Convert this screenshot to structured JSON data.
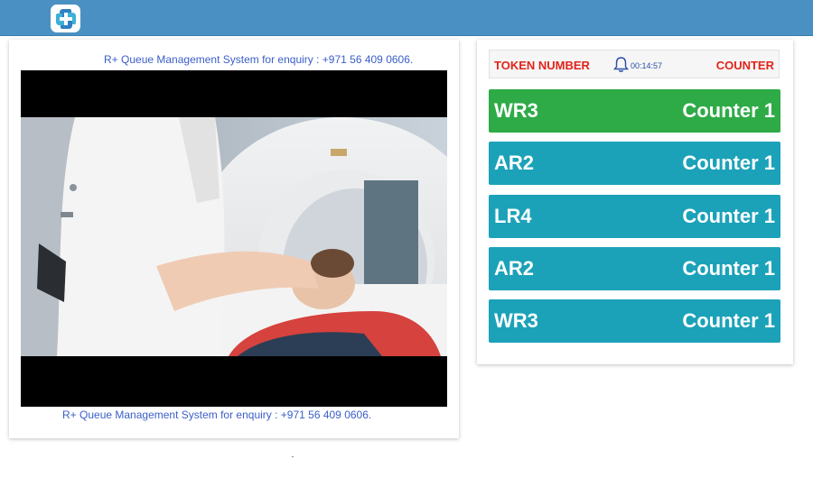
{
  "colors": {
    "topbar": "#4a90c2",
    "active_row": "#2eab47",
    "row": "#1ba2b9",
    "header_text": "#e0241b",
    "enquiry_text": "#3b5fc8"
  },
  "left_panel": {
    "enquiry_top": "R+ Queue Management System for enquiry : +971 56 409 0606.",
    "enquiry_bottom": "R+ Queue Management System for enquiry : +971 56 409 0606.",
    "video_icon": "video-player"
  },
  "right_panel": {
    "header": {
      "token_label": "TOKEN NUMBER",
      "time": "00:14:57",
      "counter_label": "COUNTER",
      "bell_icon": "bell-icon"
    },
    "rows": [
      {
        "token": "WR3",
        "counter": "Counter 1",
        "active": true
      },
      {
        "token": "AR2",
        "counter": "Counter 1",
        "active": false
      },
      {
        "token": "LR4",
        "counter": "Counter 1",
        "active": false
      },
      {
        "token": "AR2",
        "counter": "Counter 1",
        "active": false
      },
      {
        "token": "WR3",
        "counter": "Counter 1",
        "active": false
      }
    ]
  }
}
